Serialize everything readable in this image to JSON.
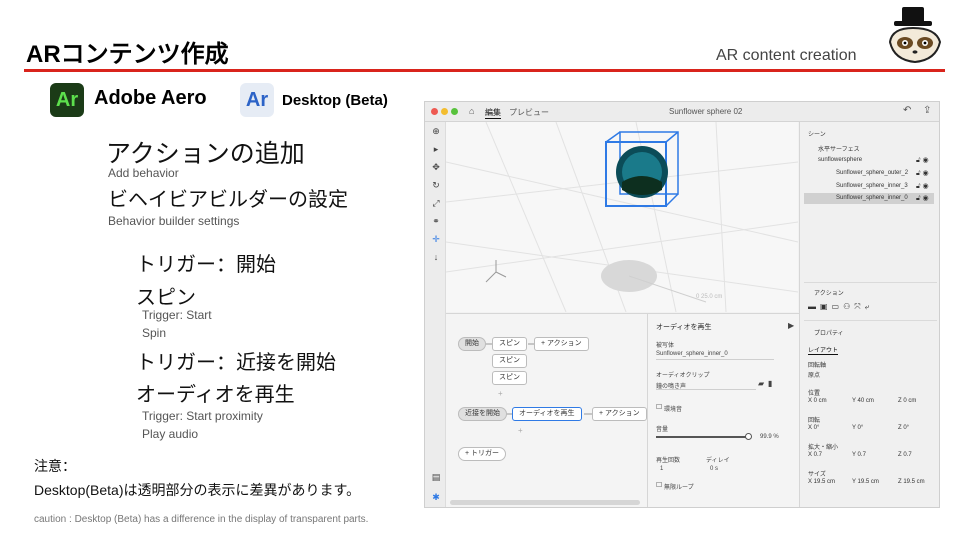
{
  "slide": {
    "title": "ARコンテンツ作成",
    "subtitle": "AR content creation",
    "aero_logo": "Ar",
    "aero_name": "Adobe Aero",
    "desktop_logo": "Ar",
    "desktop_name": "Desktop (Beta)",
    "add_action_jp": "アクションの追加",
    "add_action_en": "Add behavior",
    "builder_jp": "ビヘイビアビルダーの設定",
    "builder_en": "Behavior builder settings",
    "trigger1_jp": "トリガー：開始",
    "spin_jp": "スピン",
    "trigger1_en": "Trigger: Start",
    "spin_en": "Spin",
    "trigger2_jp": "トリガー：近接を開始",
    "audio_jp": "オーディオを再生",
    "trigger2_en": "Trigger: Start proximity",
    "audio_en": "Play audio",
    "note_label": "注意：",
    "note_text": "Desktop(Beta)は透明部分の表示に差異があります。",
    "caution_en": "caution : Desktop (Beta) has a difference in the display of transparent parts.",
    "accent_color": "#d9241c"
  },
  "app_window": {
    "menu_edit": "編集",
    "menu_preview": "プレビュー",
    "doc_title": "Sunflower sphere 02",
    "viewport_label": "0 25.0 cm",
    "scene": {
      "header": "シーン",
      "items": [
        "水平サーフェス",
        "sunflowersphere",
        "Sunflower_sphere_outer_2",
        "Sunflower_sphere_inner_3",
        "Sunflower_sphere_inner_0"
      ]
    },
    "actions_header": "アクション",
    "properties": {
      "header": "プロパティ",
      "layout": "レイアウト",
      "pivot_label": "回転軸",
      "pivot_value": "原点",
      "position_label": "位置",
      "position": [
        "X 0 cm",
        "Y 40 cm",
        "Z 0 cm"
      ],
      "rotation_label": "回転",
      "rotation": [
        "X 0°",
        "Y 0°",
        "Z 0°"
      ],
      "scale_label": "拡大・縮小",
      "scale": [
        "X 0.7",
        "Y 0.7",
        "Z 0.7"
      ],
      "size_label": "サイズ",
      "size": [
        "X 19.5 cm",
        "Y 19.5 cm",
        "Z 19.5 cm"
      ]
    },
    "behavior": {
      "trigger_start": "開始",
      "spin_1": "スピン",
      "spin_2": "スピン",
      "spin_3": "スピン",
      "add_action_1": "+ アクション",
      "trigger_proximity": "近接を開始",
      "play_audio": "オーディオを再生",
      "add_action_2": "+ アクション",
      "add_trigger": "+ トリガー",
      "plus_1": "+",
      "plus_2": "+"
    },
    "audio_props": {
      "header": "オーディオを再生",
      "target_label": "被写体",
      "target_value": "Sunflower_sphere_inner_0",
      "clip_label": "オーディオクリップ",
      "clip_value": "鐘の鳴き声",
      "ambient_label": "環境音",
      "volume_label": "音量",
      "volume_value": "99.9 %",
      "volume_fraction": 0.999,
      "repeat_label": "再生回数",
      "repeat_value": "1",
      "delay_label": "ディレイ",
      "delay_value": "0 s",
      "loop_label": "無限ループ"
    }
  }
}
